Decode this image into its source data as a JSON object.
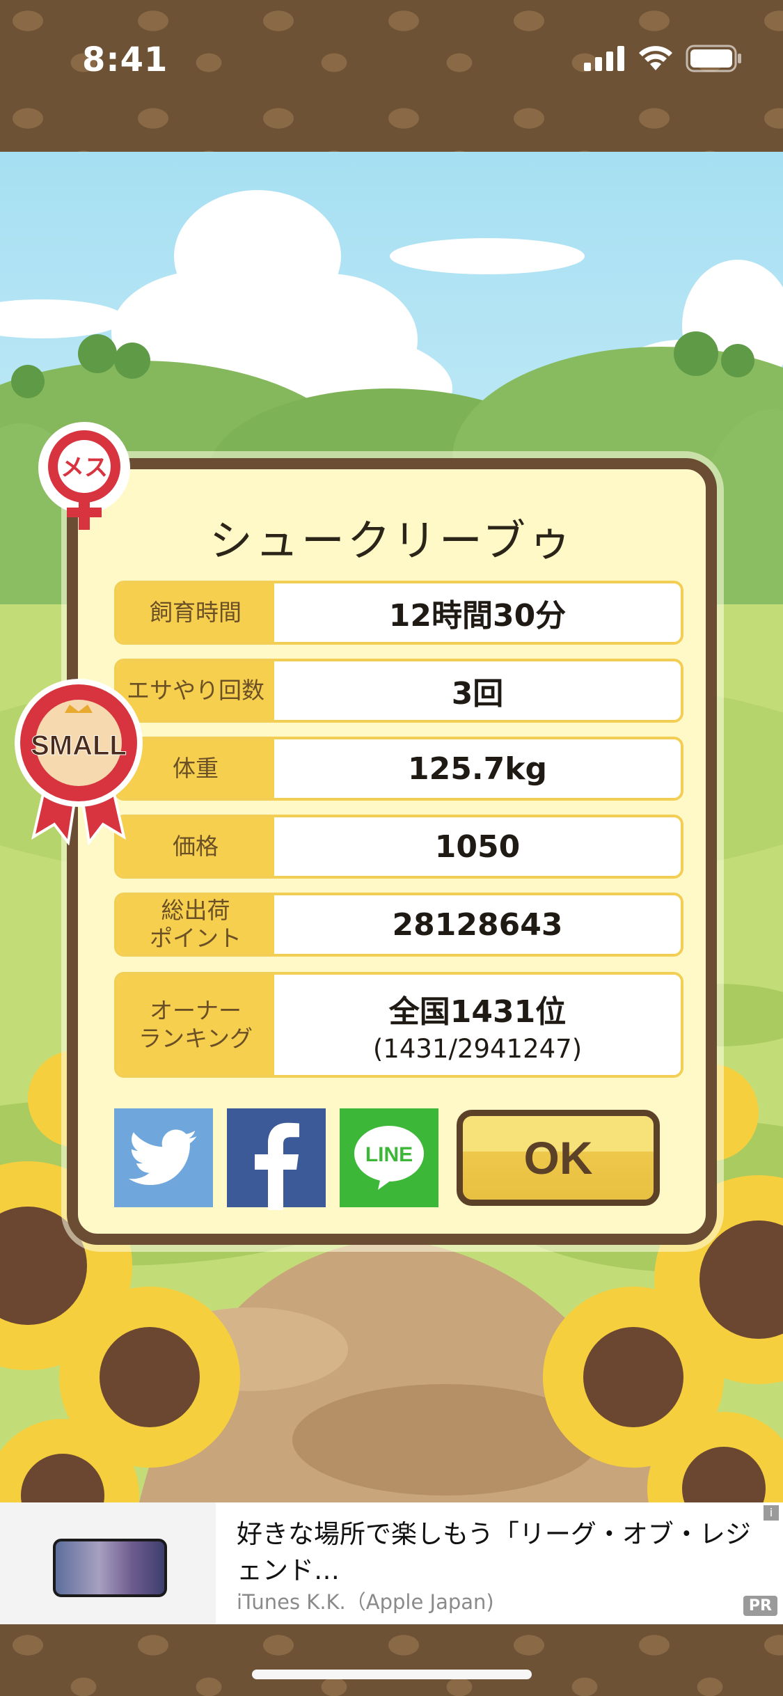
{
  "status_bar": {
    "time": "8:41"
  },
  "dialog": {
    "title": "シュークリーブゥ",
    "rows": [
      {
        "label": "飼育時間",
        "value": "12時間30分"
      },
      {
        "label": "エサやり回数",
        "value": "3回"
      },
      {
        "label": "体重",
        "value": "125.7kg"
      },
      {
        "label": "価格",
        "value": "1050"
      },
      {
        "label": "総出荷\nポイント",
        "value": "28128643"
      },
      {
        "label": "オーナー\nランキング",
        "value": "全国1431位",
        "sub": "(1431/2941247)"
      }
    ],
    "ok_label": "OK",
    "line_label": "LINE"
  },
  "badges": {
    "gender": "メス",
    "size": "SMALL"
  },
  "ad": {
    "title": "好きな場所で楽しもう「リーグ・オブ・レジェンド…",
    "publisher": "iTunes K.K.（Apple Japan)",
    "pr_label": "PR",
    "info_label": "i"
  },
  "colors": {
    "frame_brown": "#6b4d33",
    "label_yellow": "#f6cf4f",
    "panel_cream": "#fff9c8"
  }
}
